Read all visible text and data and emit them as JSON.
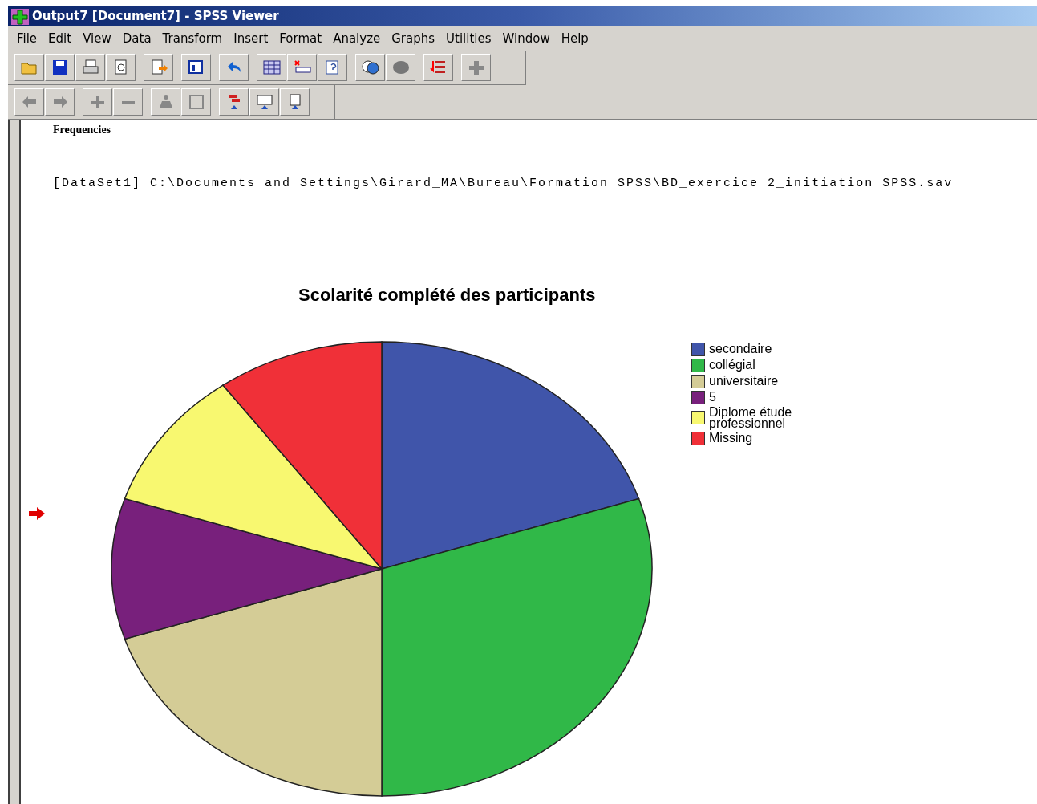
{
  "window": {
    "title": "Output7 [Document7] - SPSS Viewer"
  },
  "menu": [
    "File",
    "Edit",
    "View",
    "Data",
    "Transform",
    "Insert",
    "Format",
    "Analyze",
    "Graphs",
    "Utilities",
    "Window",
    "Help"
  ],
  "output": {
    "heading": "Frequencies",
    "dataset_line": "[DataSet1] C:\\Documents and Settings\\Girard_MA\\Bureau\\Formation SPSS\\BD_exercice 2_initiation SPSS.sav",
    "chart": {
      "title": "Scolarité complété des participants",
      "legend": [
        {
          "label": "secondaire",
          "color": "#4055aa"
        },
        {
          "label": "collégial",
          "color": "#30b848"
        },
        {
          "label": "universitaire",
          "color": "#d4cc96"
        },
        {
          "label": "5",
          "color": "#78207c"
        },
        {
          "label": "Diplome étude professionnel",
          "color": "#f8f870"
        },
        {
          "label": "Missing",
          "color": "#f03038"
        }
      ]
    }
  }
}
